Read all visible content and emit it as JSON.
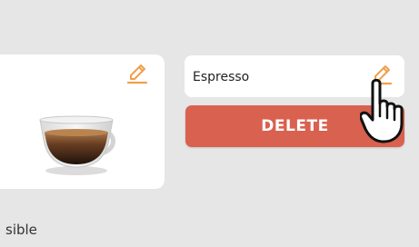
{
  "colors": {
    "background": "#e6e6e6",
    "card": "#ffffff",
    "accent_edit": "#f0a04b",
    "delete_button": "#d9614f"
  },
  "card": {
    "edit_icon": "pencil-edit-icon",
    "image": "espresso-cup-image"
  },
  "name_field": {
    "value": "Espresso",
    "edit_icon": "pencil-edit-icon"
  },
  "delete_button": {
    "label": "DELETE"
  },
  "footer": {
    "text": "sible"
  },
  "cursor": {
    "icon": "hand-pointer-cursor-icon"
  }
}
